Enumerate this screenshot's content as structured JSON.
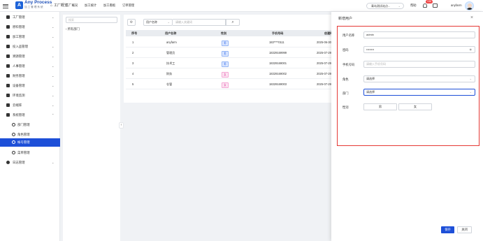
{
  "brand": {
    "name": "Any Process",
    "subtitle": "加工管理系统",
    "logo_letter": "A"
  },
  "topnav": {
    "home": "工厂概览",
    "tabs": [
      "工厂概况",
      "加工统计",
      "加工看板",
      "订单管理"
    ],
    "factory_select": "青岛测试站点...",
    "help": "帮助",
    "badge": "136",
    "user": "anyfarm"
  },
  "sidebar": {
    "items": [
      {
        "label": "工厂管理",
        "chev": "⌄"
      },
      {
        "label": "原料管理",
        "chev": "⌄"
      },
      {
        "label": "加工管理",
        "chev": "⌄"
      },
      {
        "label": "投入品管理",
        "chev": "⌄"
      },
      {
        "label": "溯源管理",
        "chev": "⌄"
      },
      {
        "label": "人事管理",
        "chev": "⌄"
      },
      {
        "label": "财务管理",
        "chev": "⌄"
      },
      {
        "label": "设备管理",
        "chev": "⌄"
      },
      {
        "label": "环境监测",
        "chev": "⌄"
      },
      {
        "label": "云端库",
        "chev": "⌄"
      },
      {
        "label": "系统管理",
        "chev": "⌃"
      }
    ],
    "subs": [
      "部门管理",
      "角色管理",
      "帐号管理",
      "菜单管理"
    ],
    "last": {
      "label": "日志管理",
      "chev": "⌄"
    }
  },
  "tree": {
    "placeholder": "搜索",
    "node": "所有部门",
    "node_chev": "›"
  },
  "collapse_glyph": "‹",
  "toolbar": {
    "gear": "⚙",
    "field": "用户名称",
    "field_chev": "⌄",
    "search_placeholder": "请输入关键词",
    "search_icon": "⌕"
  },
  "table": {
    "headers": [
      "序号",
      "用户名称",
      "性别",
      "手机号码",
      "创建时"
    ],
    "rows": [
      {
        "no": "1",
        "name": "anyfarm",
        "gender": "男",
        "phone": "183****0111",
        "created": "2025-06-30",
        "gtype": "m"
      },
      {
        "no": "2",
        "name": "管理员",
        "gender": "男",
        "phone": "18329169999",
        "created": "2025-07-29",
        "gtype": "m"
      },
      {
        "no": "3",
        "name": "技术工",
        "gender": "男",
        "phone": "18329169001",
        "created": "2025-07-29",
        "gtype": "m"
      },
      {
        "no": "4",
        "name": "财务",
        "gender": "女",
        "phone": "18329169002",
        "created": "2025-07-29",
        "gtype": "f"
      },
      {
        "no": "5",
        "name": "仓管",
        "gender": "女",
        "phone": "18329169003",
        "created": "2025-07-29",
        "gtype": "f"
      }
    ]
  },
  "dialog": {
    "title": "新增用户",
    "close": "×",
    "fields": {
      "username_label": "用户名称",
      "username_value": "admin",
      "password_label": "密码",
      "password_value": "••••••••",
      "phone_label": "手机号码",
      "phone_placeholder": "请输入手机号码",
      "role_label": "角色",
      "role_placeholder": "请选择",
      "dept_label": "部门",
      "dept_placeholder": "请选择",
      "gender_label": "性别",
      "male": "男",
      "female": "女"
    },
    "save": "保存",
    "cancel": "关闭"
  },
  "colors": {
    "primary": "#1d4fd8",
    "danger": "#e53935"
  }
}
